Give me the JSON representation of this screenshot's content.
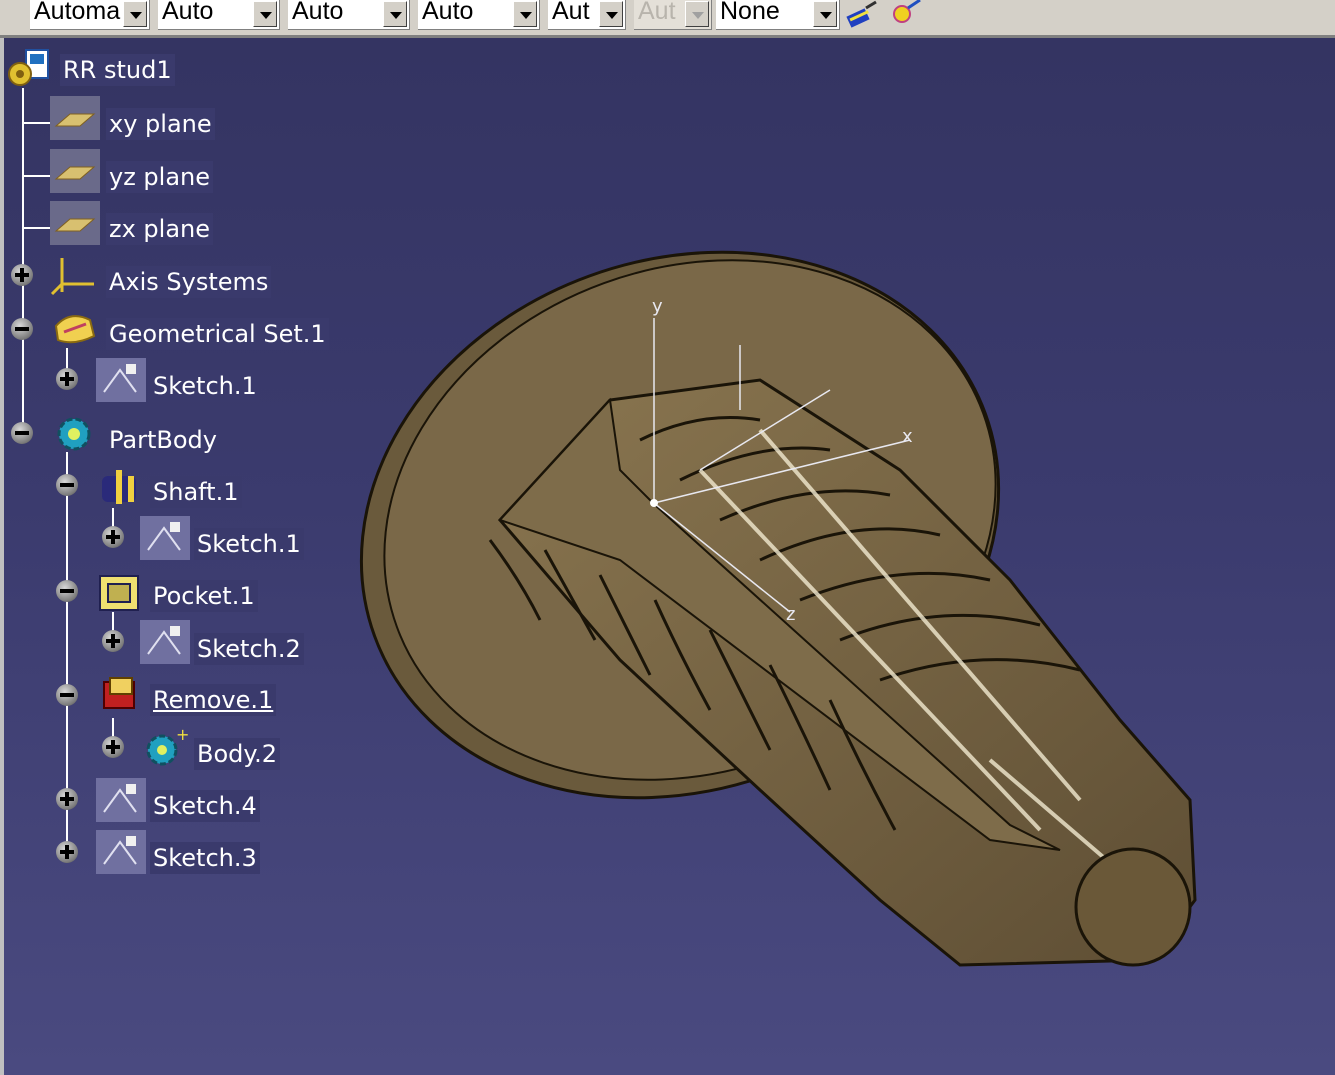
{
  "toolbar": {
    "combos": [
      "Automa",
      "Auto",
      "Auto",
      "Auto",
      "Aut",
      "Aut",
      "None"
    ],
    "combo_disabled_index": 5,
    "icons": [
      "paint-brush-icon",
      "magic-wand-icon"
    ]
  },
  "tree": {
    "root": "RR stud1",
    "planes": [
      "xy plane",
      "yz plane",
      "zx plane"
    ],
    "axis_systems": "Axis Systems",
    "geometrical_set": "Geometrical Set.1",
    "geo_sketch": "Sketch.1",
    "partbody": "PartBody",
    "shaft": "Shaft.1",
    "shaft_sketch": "Sketch.1",
    "pocket": "Pocket.1",
    "pocket_sketch": "Sketch.2",
    "remove": "Remove.1",
    "remove_body": "Body.2",
    "sketch4": "Sketch.4",
    "sketch3": "Sketch.3"
  },
  "viewport": {
    "axis_labels": [
      "y",
      "x",
      "z"
    ],
    "model_color": "#6e5d40",
    "background_color": "#3b3b6e"
  }
}
